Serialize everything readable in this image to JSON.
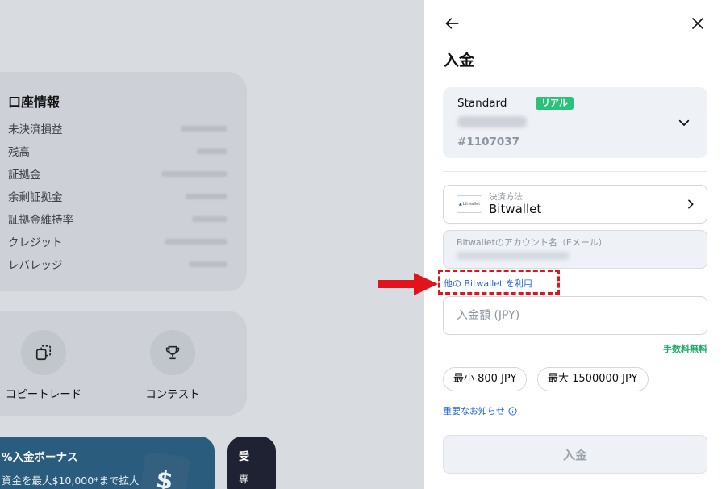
{
  "background": {
    "account_info": {
      "title": "口座情報",
      "rows": [
        "未決済損益",
        "残高",
        "証拠金",
        "余剰証拠金",
        "証拠金維持率",
        "クレジット",
        "レバレッジ"
      ]
    },
    "actions": [
      {
        "label": "コピートレード",
        "icon": "copy-icon"
      },
      {
        "label": "コンテスト",
        "icon": "trophy-icon"
      }
    ],
    "promo": {
      "title": "%入金ボーナス",
      "subtitle": "資金を最大$10,000*まで拡大",
      "cube_symbol": "$"
    },
    "promo2": {
      "title": "受",
      "subtitle": "専"
    }
  },
  "panel": {
    "title": "入金",
    "account": {
      "type": "Standard",
      "badge": "リアル",
      "badge_color": "#2cc07a",
      "number": "#1107037"
    },
    "payment_method": {
      "caption": "決済方法",
      "name": "Bitwallet",
      "logo_text": "bitwallet"
    },
    "email_field": {
      "label": "Bitwalletのアカウント名（Eメール）"
    },
    "other_link": "他の Bitwallet を利用",
    "amount": {
      "placeholder": "入金額 (JPY)"
    },
    "fee": "手数料無料",
    "limits": {
      "min": "最小 800 JPY",
      "max": "最大 1500000 JPY"
    },
    "notice": "重要なお知らせ",
    "submit": "入金"
  },
  "colors": {
    "link": "#2768d4",
    "fee": "#22a867",
    "annotation": "#e1141b"
  }
}
